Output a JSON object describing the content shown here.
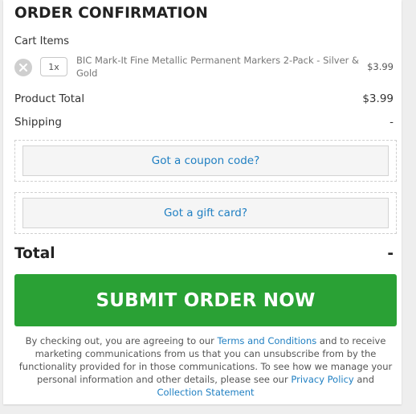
{
  "title": "ORDER CONFIRMATION",
  "cart": {
    "label": "Cart Items",
    "item": {
      "quantity": "1x",
      "name": "BIC Mark-It Fine Metallic Permanent Markers 2-Pack - Silver & Gold",
      "price": "$3.99",
      "remove_icon": "close-icon"
    }
  },
  "summary": {
    "product_total_label": "Product Total",
    "product_total_value": "$3.99",
    "shipping_label": "Shipping",
    "shipping_value": "-"
  },
  "coupon": {
    "label": "Got a coupon code?"
  },
  "gift_card": {
    "label": "Got a gift card?"
  },
  "total": {
    "label": "Total",
    "value": "-"
  },
  "submit": {
    "label": "SUBMIT ORDER NOW"
  },
  "legal": {
    "part1": "By checking out, you are agreeing to our ",
    "terms_link": "Terms and Conditions",
    "part2": " and to receive marketing communications from us that you can unsubscribe from by the functionality provided for in those communications. To see how we manage your personal information and other details, please see our ",
    "privacy_link": "Privacy Policy",
    "part3": " and ",
    "collection_link": "Collection Statement"
  },
  "colors": {
    "accent": "#2aa135",
    "link": "#1f7fc2",
    "background": "#eeeeee"
  }
}
